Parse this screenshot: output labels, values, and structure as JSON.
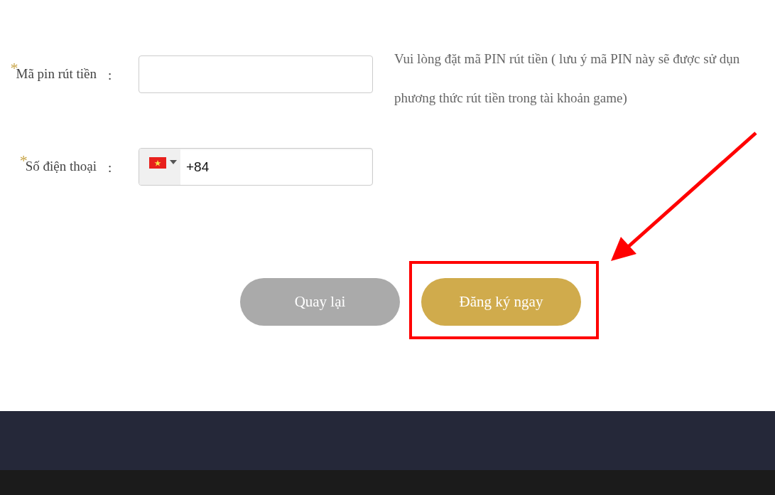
{
  "form": {
    "required_mark": "*",
    "fields": [
      {
        "kind": "text",
        "label": "Mã pin rút tiền",
        "separator": ":",
        "required": true,
        "hint_lines": [
          "Vui lòng đặt mã PIN rút tiền ( lưu ý mã PIN này sẽ được sử dụn",
          "phương thức rút tiền trong tài khoản game)"
        ]
      },
      {
        "kind": "phone",
        "label": "Số điện thoại",
        "separator": ":",
        "required": true,
        "value": "+84"
      }
    ]
  },
  "buttons": [
    {
      "label": "Quay lại",
      "kind": "secondary"
    },
    {
      "label": "Đăng ký ngay",
      "kind": "primary"
    }
  ]
}
